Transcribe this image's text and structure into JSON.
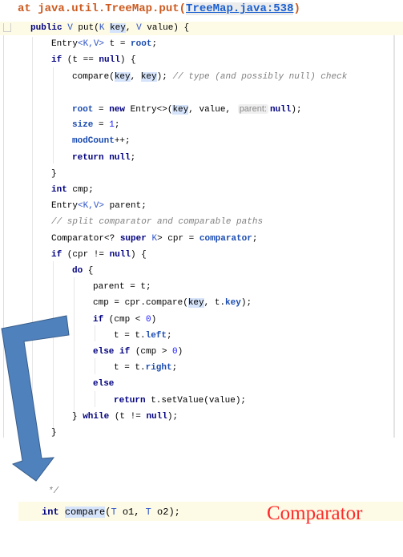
{
  "header": {
    "prefix": "at java.util.TreeMap.put(",
    "link": "TreeMap.java:538",
    "suffix": ")"
  },
  "code": [
    {
      "indent": 0,
      "tokens": [
        [
          "public ",
          "kw"
        ],
        [
          "V",
          "typ"
        ],
        [
          " put(",
          ""
        ],
        [
          "K",
          "typ"
        ],
        [
          " ",
          ""
        ],
        [
          "key",
          "hl"
        ],
        [
          ", ",
          ""
        ],
        [
          "V",
          "typ"
        ],
        [
          " value) {",
          ""
        ]
      ]
    },
    {
      "indent": 1,
      "tokens": [
        [
          "Entry",
          ""
        ],
        [
          "<K,V>",
          "typ"
        ],
        [
          " t = ",
          ""
        ],
        [
          "root",
          "fld"
        ],
        [
          ";",
          ""
        ]
      ]
    },
    {
      "indent": 1,
      "tokens": [
        [
          "if",
          "kw"
        ],
        [
          " (t == ",
          ""
        ],
        [
          "null",
          "kw"
        ],
        [
          ") {",
          ""
        ]
      ]
    },
    {
      "indent": 2,
      "tokens": [
        [
          "compare(",
          ""
        ],
        [
          "key",
          "hl"
        ],
        [
          ", ",
          ""
        ],
        [
          "key",
          "hl"
        ],
        [
          "); ",
          ""
        ],
        [
          "// type (and possibly null) check",
          "cm"
        ]
      ]
    },
    {
      "indent": 2,
      "tokens": []
    },
    {
      "indent": 2,
      "tokens": [
        [
          "root",
          "fld"
        ],
        [
          " = ",
          ""
        ],
        [
          "new",
          "kw"
        ],
        [
          " Entry<>(",
          ""
        ],
        [
          "key",
          "hl"
        ],
        [
          ", value, ",
          ""
        ],
        [
          "parent:",
          "hint"
        ],
        [
          "null",
          "kw"
        ],
        [
          ");",
          ""
        ]
      ]
    },
    {
      "indent": 2,
      "tokens": [
        [
          "size",
          "fld"
        ],
        [
          " = ",
          ""
        ],
        [
          "1",
          "num"
        ],
        [
          ";",
          ""
        ]
      ]
    },
    {
      "indent": 2,
      "tokens": [
        [
          "modCount",
          "fld"
        ],
        [
          "++;",
          ""
        ]
      ]
    },
    {
      "indent": 2,
      "tokens": [
        [
          "return null",
          "kw"
        ],
        [
          ";",
          ""
        ]
      ]
    },
    {
      "indent": 1,
      "tokens": [
        [
          "}",
          ""
        ]
      ]
    },
    {
      "indent": 1,
      "tokens": [
        [
          "int",
          "kw"
        ],
        [
          " cmp;",
          ""
        ]
      ]
    },
    {
      "indent": 1,
      "tokens": [
        [
          "Entry",
          ""
        ],
        [
          "<K,V>",
          "typ"
        ],
        [
          " parent;",
          ""
        ]
      ]
    },
    {
      "indent": 1,
      "tokens": [
        [
          "// split comparator and comparable paths",
          "cm"
        ]
      ]
    },
    {
      "indent": 1,
      "tokens": [
        [
          "Comparator<? ",
          ""
        ],
        [
          "super",
          "kw"
        ],
        [
          " ",
          ""
        ],
        [
          "K",
          "typ"
        ],
        [
          "> cpr = ",
          ""
        ],
        [
          "comparator",
          "fld"
        ],
        [
          ";",
          ""
        ]
      ]
    },
    {
      "indent": 1,
      "tokens": [
        [
          "if",
          "kw"
        ],
        [
          " (cpr != ",
          ""
        ],
        [
          "null",
          "kw"
        ],
        [
          ") {",
          ""
        ]
      ]
    },
    {
      "indent": 2,
      "tokens": [
        [
          "do",
          "kw"
        ],
        [
          " {",
          ""
        ]
      ]
    },
    {
      "indent": 3,
      "tokens": [
        [
          "parent = t;",
          ""
        ]
      ]
    },
    {
      "indent": 3,
      "tokens": [
        [
          "cmp = cpr.compare(",
          ""
        ],
        [
          "key",
          "hl"
        ],
        [
          ", t.",
          ""
        ],
        [
          "key",
          "fld"
        ],
        [
          ");",
          ""
        ]
      ]
    },
    {
      "indent": 3,
      "tokens": [
        [
          "if",
          "kw"
        ],
        [
          " (cmp < ",
          ""
        ],
        [
          "0",
          "num"
        ],
        [
          ")",
          ""
        ]
      ]
    },
    {
      "indent": 4,
      "tokens": [
        [
          "t = t.",
          ""
        ],
        [
          "left",
          "fld"
        ],
        [
          ";",
          ""
        ]
      ]
    },
    {
      "indent": 3,
      "tokens": [
        [
          "else if",
          "kw"
        ],
        [
          " (cmp > ",
          ""
        ],
        [
          "0",
          "num"
        ],
        [
          ")",
          ""
        ]
      ]
    },
    {
      "indent": 4,
      "tokens": [
        [
          "t = t.",
          ""
        ],
        [
          "right",
          "fld"
        ],
        [
          ";",
          ""
        ]
      ]
    },
    {
      "indent": 3,
      "tokens": [
        [
          "else",
          "kw"
        ]
      ]
    },
    {
      "indent": 4,
      "tokens": [
        [
          "return",
          "kw"
        ],
        [
          " t.setValue(value);",
          ""
        ]
      ]
    },
    {
      "indent": 2,
      "tokens": [
        [
          "} ",
          ""
        ],
        [
          "while",
          "kw"
        ],
        [
          " (t != ",
          ""
        ],
        [
          "null",
          "kw"
        ],
        [
          ");",
          ""
        ]
      ]
    },
    {
      "indent": 1,
      "tokens": [
        [
          "}",
          ""
        ]
      ]
    }
  ],
  "bottom": {
    "comment_end": "*/",
    "sig": [
      [
        "int",
        "kw"
      ],
      [
        " ",
        ""
      ],
      [
        "compare",
        "hl"
      ],
      [
        "(",
        ""
      ],
      [
        "T",
        "typ"
      ],
      [
        " o1, ",
        ""
      ],
      [
        "T",
        "typ"
      ],
      [
        " o2);",
        ""
      ]
    ]
  },
  "annotation": {
    "label": "Comparator",
    "color": "#ff2a2a",
    "arrow_color": "#4f81bd"
  }
}
